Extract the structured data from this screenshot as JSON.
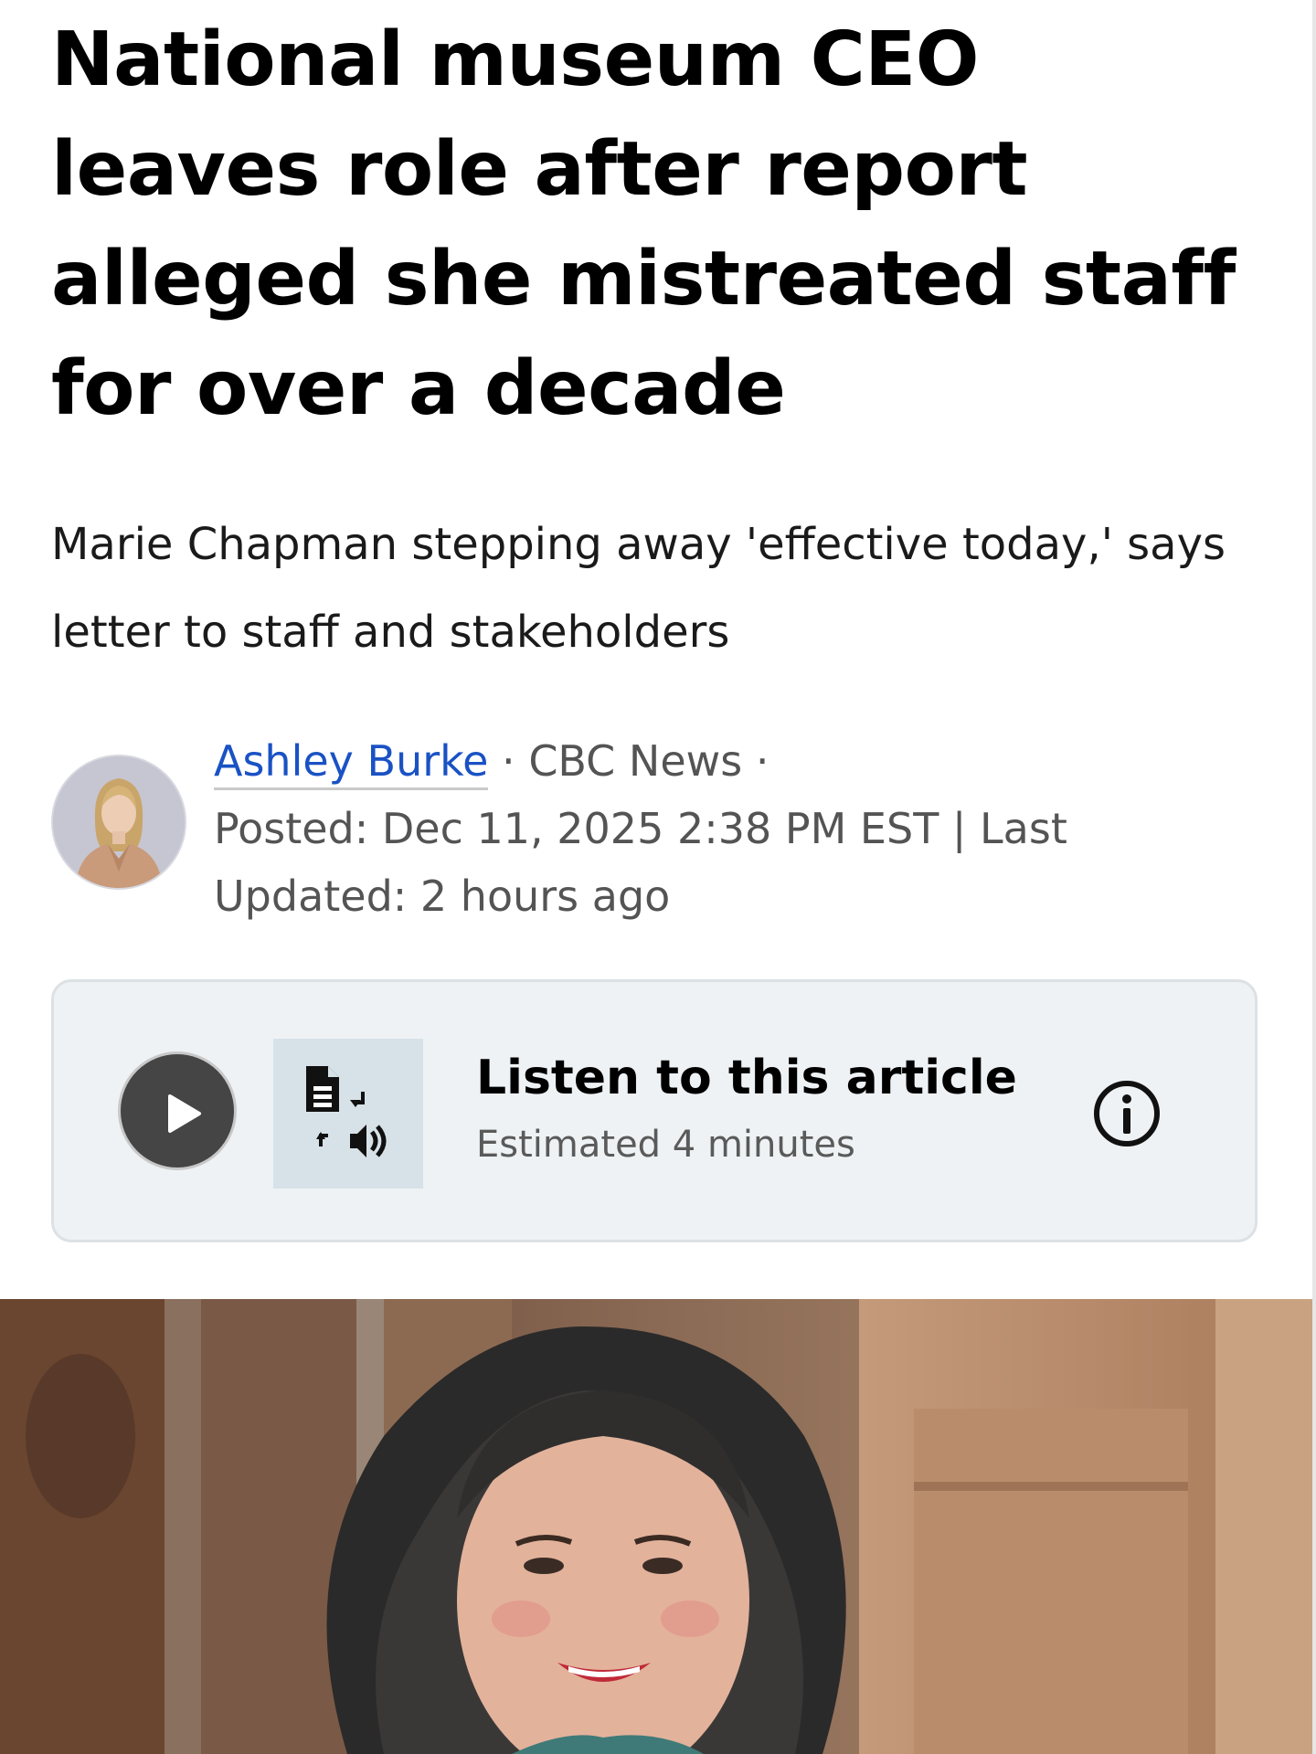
{
  "article": {
    "headline": "National museum CEO leaves role after report alleged she mistreated staff for over a decade",
    "deck": "Marie Chapman stepping away 'effective today,' says letter to staff and stakeholders"
  },
  "byline": {
    "author": "Ashley Burke",
    "separator_1": " · ",
    "outlet": "CBC News",
    "separator_2": " ·",
    "posted": "Posted: Dec 11, 2025 2:38 PM EST | Last Updated: 2 hours ago"
  },
  "listen": {
    "title": "Listen to this article",
    "estimate": "Estimated 4 minutes",
    "play_icon": "play-icon",
    "tts_icon": "text-to-speech-icon",
    "info_icon": "info-icon"
  },
  "colors": {
    "author_link": "#1a52c4",
    "listen_card_bg": "#eef2f4",
    "play_button": "#454545"
  }
}
